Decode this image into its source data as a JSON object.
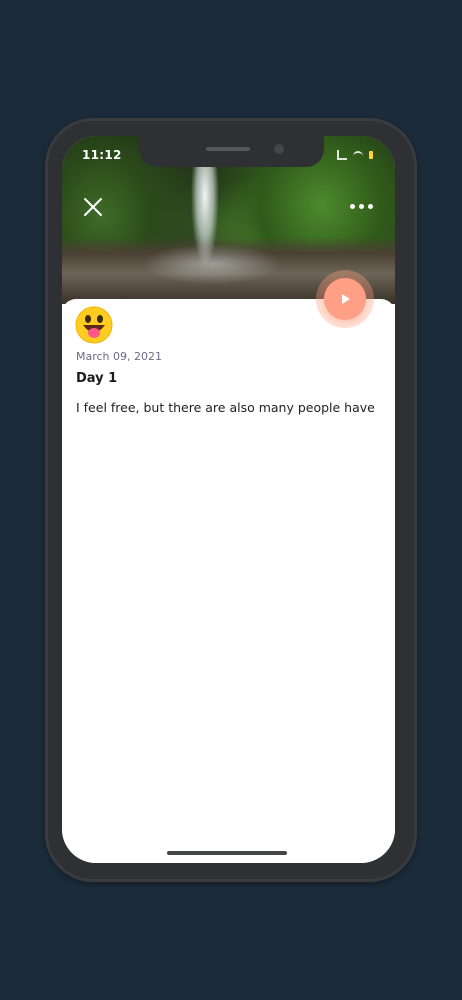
{
  "status_bar": {
    "time": "11:12"
  },
  "hero": {
    "image_description": "waterfall-canyon-photo"
  },
  "toolbar": {
    "close_icon": "close-icon",
    "more_icon": "more-dots-icon"
  },
  "player": {
    "play_icon": "play-icon"
  },
  "entry": {
    "mood_icon": "tongue-out-face-emoji",
    "date": "March 09, 2021",
    "title": "Day 1",
    "body": "I feel free, but there are also many people have"
  },
  "colors": {
    "background": "#1b2b3a",
    "accent": "#ff9f86",
    "date_text": "#6d6a88"
  }
}
